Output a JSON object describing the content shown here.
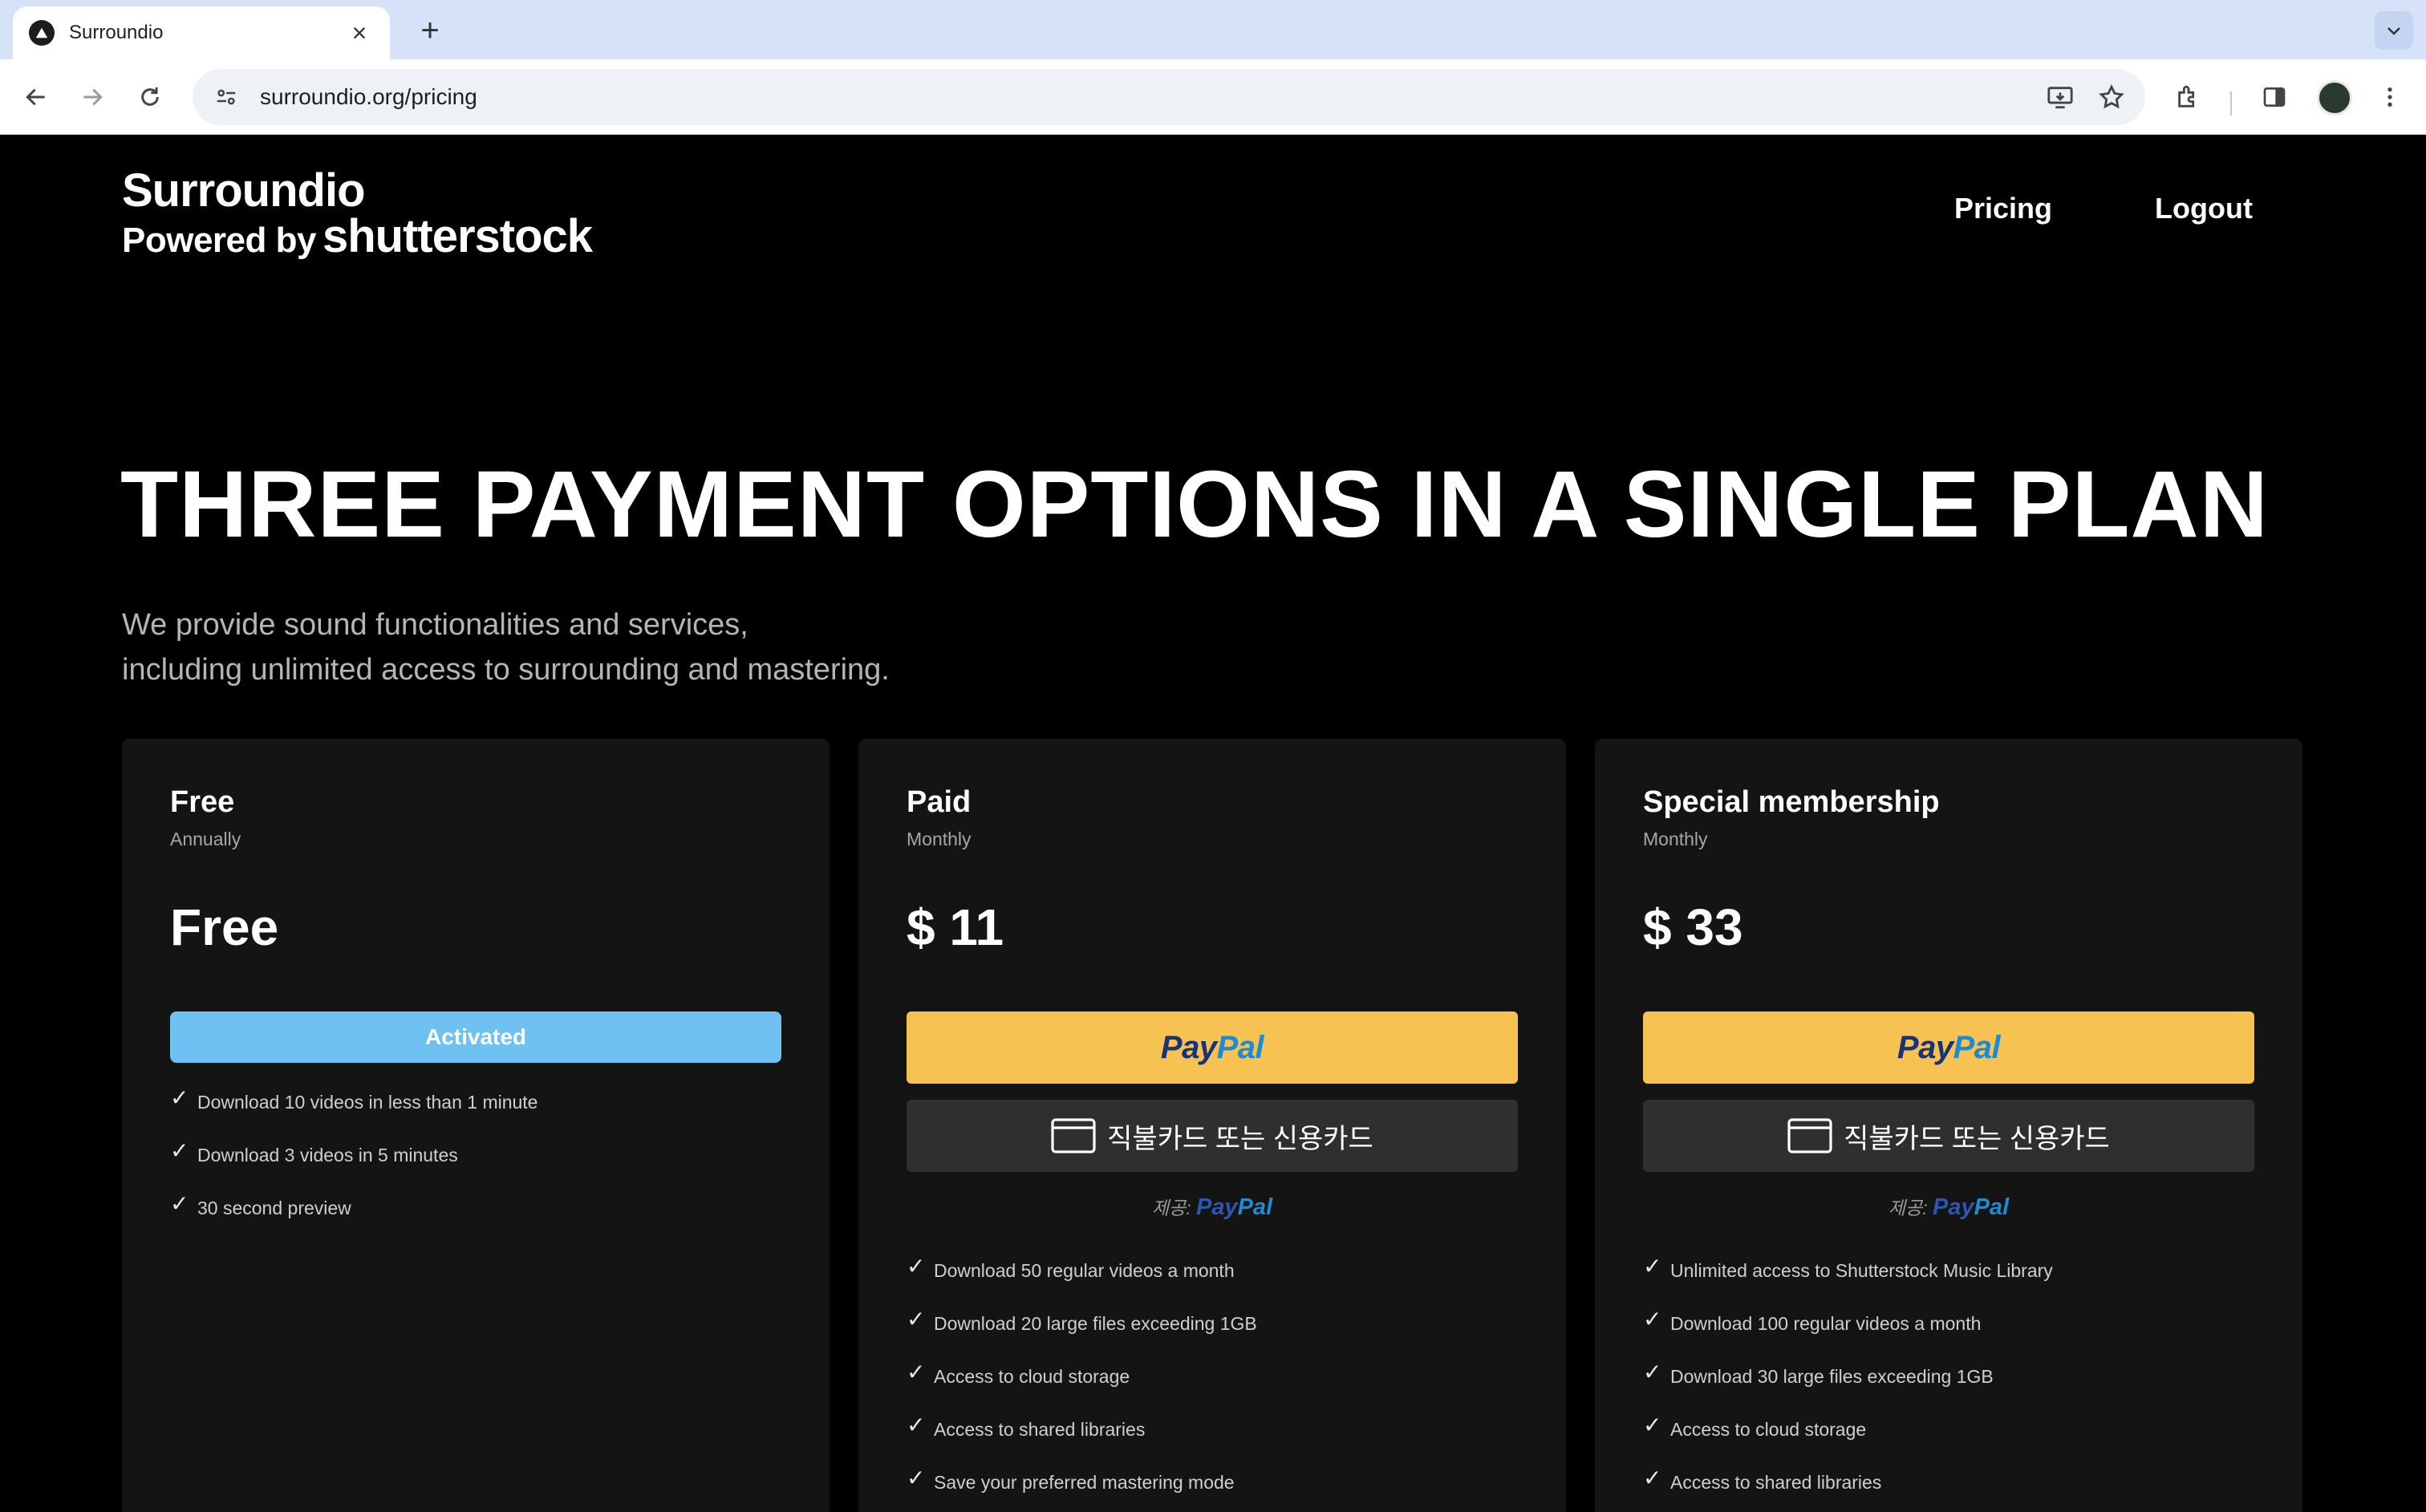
{
  "browser": {
    "tab_title": "Surroundio",
    "url": "surroundio.org/pricing"
  },
  "header": {
    "logo_name": "Surroundio",
    "logo_powered": "Powered by",
    "logo_brand": "shutterstock",
    "nav": [
      "Pricing",
      "Logout"
    ]
  },
  "hero": {
    "title": "THREE PAYMENT OPTIONS IN A SINGLE PLAN",
    "subtitle_line1": "We provide sound functionalities and services,",
    "subtitle_line2": "including unlimited access to surrounding and mastering."
  },
  "plans": [
    {
      "name": "Free",
      "period": "Annually",
      "price": "Free",
      "button": "Activated",
      "features": [
        "Download 10 videos in less than 1 minute",
        "Download 3 videos in 5 minutes",
        "30 second preview"
      ]
    },
    {
      "name": "Paid",
      "period": "Monthly",
      "price": "$ 11",
      "paypal_a": "Pay",
      "paypal_b": "Pal",
      "card_button": "직불카드 또는 신용카드",
      "powered_by": "제공:",
      "features": [
        "Download 50 regular videos a month",
        "Download 20 large files exceeding 1GB",
        "Access to cloud storage",
        "Access to shared libraries",
        "Save your preferred mastering mode"
      ]
    },
    {
      "name": "Special membership",
      "period": "Monthly",
      "price": "$ 33",
      "paypal_a": "Pay",
      "paypal_b": "Pal",
      "card_button": "직불카드 또는 신용카드",
      "powered_by": "제공:",
      "features": [
        "Unlimited access to Shutterstock Music Library",
        "Download 100 regular videos a month",
        "Download 30 large files exceeding 1GB",
        "Access to cloud storage",
        "Access to shared libraries"
      ]
    }
  ],
  "colors": {
    "activated": "#6ec1f1",
    "paypal_yellow": "#f6c353",
    "paypal_dark_blue": "#1b3276",
    "paypal_light_blue": "#1d8ad1",
    "card_bg": "#141414"
  },
  "icons": {
    "check": "✓"
  }
}
